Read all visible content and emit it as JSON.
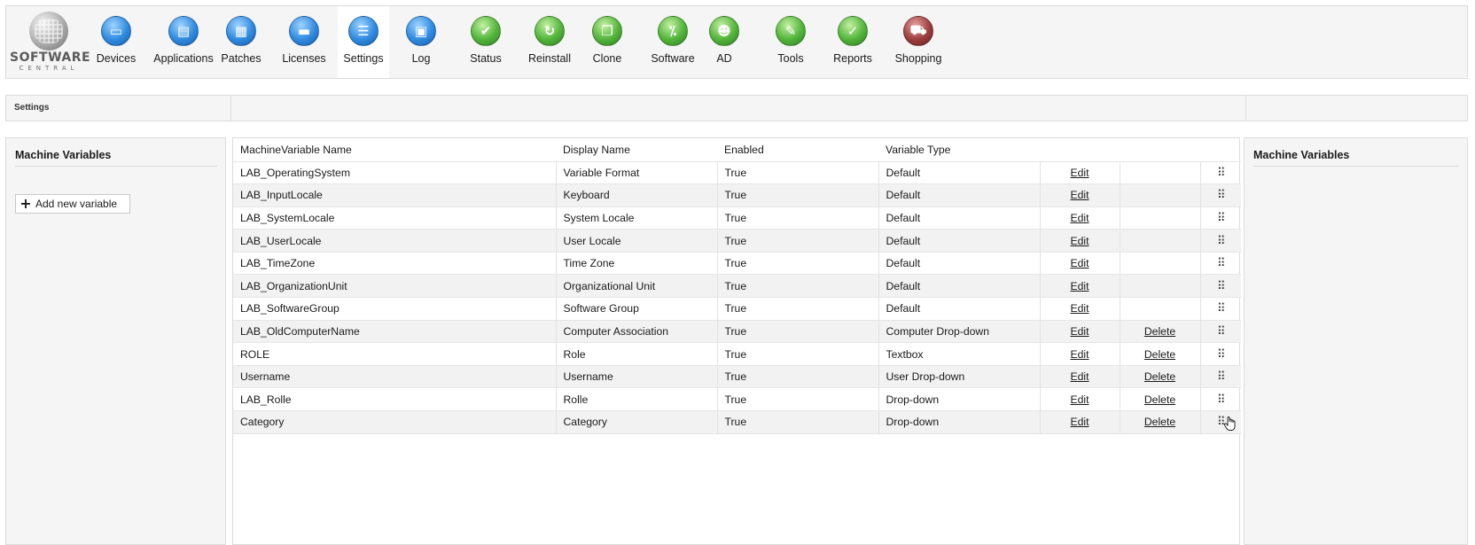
{
  "logo": {
    "text": "SOFTWARE",
    "sub": "CENTRAL"
  },
  "nav": [
    {
      "label": "Devices",
      "icon": "monitor-icon",
      "glyph": "▭",
      "color": "blue"
    },
    {
      "label": "Applications",
      "icon": "applications-icon",
      "glyph": "▤",
      "color": "blue"
    },
    {
      "label": "Patches",
      "icon": "patches-icon",
      "glyph": "▦",
      "color": "blue"
    },
    {
      "label": "Licenses",
      "icon": "licenses-icon",
      "glyph": "▬",
      "color": "blue"
    },
    {
      "label": "Settings",
      "icon": "settings-icon",
      "glyph": "☰",
      "color": "blue",
      "active": true
    },
    {
      "label": "Log",
      "icon": "log-icon",
      "glyph": "▣",
      "color": "blue"
    },
    {
      "label": "Status",
      "icon": "status-icon",
      "glyph": "✔",
      "color": "green"
    },
    {
      "label": "Reinstall",
      "icon": "reinstall-icon",
      "glyph": "↻",
      "color": "green"
    },
    {
      "label": "Clone",
      "icon": "clone-icon",
      "glyph": "❐",
      "color": "green"
    },
    {
      "label": "Software",
      "icon": "software-icon",
      "glyph": "⁒",
      "color": "green"
    },
    {
      "label": "AD",
      "icon": "ad-users-icon",
      "glyph": "☻",
      "color": "green"
    },
    {
      "label": "Tools",
      "icon": "tools-icon",
      "glyph": "✎",
      "color": "green"
    },
    {
      "label": "Reports",
      "icon": "reports-icon",
      "glyph": "✓",
      "color": "green"
    },
    {
      "label": "Shopping",
      "icon": "shopping-cart-icon",
      "glyph": "⛟",
      "color": "maroon"
    }
  ],
  "breadcrumb": {
    "current": "Settings"
  },
  "left_panel": {
    "title": "Machine Variables",
    "add_button": "Add new variable"
  },
  "right_panel": {
    "title": "Machine Variables"
  },
  "table": {
    "columns": [
      "MachineVariable Name",
      "Display Name",
      "Enabled",
      "Variable Type",
      "",
      "",
      ""
    ],
    "rows": [
      {
        "name": "LAB_OperatingSystem",
        "display": "Variable Format",
        "enabled": "True",
        "type": "Default",
        "edit": "Edit",
        "delete": ""
      },
      {
        "name": "LAB_InputLocale",
        "display": "Keyboard",
        "enabled": "True",
        "type": "Default",
        "edit": "Edit",
        "delete": ""
      },
      {
        "name": "LAB_SystemLocale",
        "display": "System Locale",
        "enabled": "True",
        "type": "Default",
        "edit": "Edit",
        "delete": ""
      },
      {
        "name": "LAB_UserLocale",
        "display": "User Locale",
        "enabled": "True",
        "type": "Default",
        "edit": "Edit",
        "delete": ""
      },
      {
        "name": "LAB_TimeZone",
        "display": "Time Zone",
        "enabled": "True",
        "type": "Default",
        "edit": "Edit",
        "delete": ""
      },
      {
        "name": "LAB_OrganizationUnit",
        "display": "Organizational Unit",
        "enabled": "True",
        "type": "Default",
        "edit": "Edit",
        "delete": ""
      },
      {
        "name": "LAB_SoftwareGroup",
        "display": "Software Group",
        "enabled": "True",
        "type": "Default",
        "edit": "Edit",
        "delete": ""
      },
      {
        "name": "LAB_OldComputerName",
        "display": "Computer Association",
        "enabled": "True",
        "type": "Computer Drop-down",
        "edit": "Edit",
        "delete": "Delete"
      },
      {
        "name": "ROLE",
        "display": "Role",
        "enabled": "True",
        "type": "Textbox",
        "edit": "Edit",
        "delete": "Delete"
      },
      {
        "name": "Username",
        "display": "Username",
        "enabled": "True",
        "type": "User Drop-down",
        "edit": "Edit",
        "delete": "Delete"
      },
      {
        "name": "LAB_Rolle",
        "display": "Rolle",
        "enabled": "True",
        "type": "Drop-down",
        "edit": "Edit",
        "delete": "Delete"
      },
      {
        "name": "Category",
        "display": "Category",
        "enabled": "True",
        "type": "Drop-down",
        "edit": "Edit",
        "delete": "Delete"
      }
    ],
    "grip_glyph": "⠿"
  }
}
